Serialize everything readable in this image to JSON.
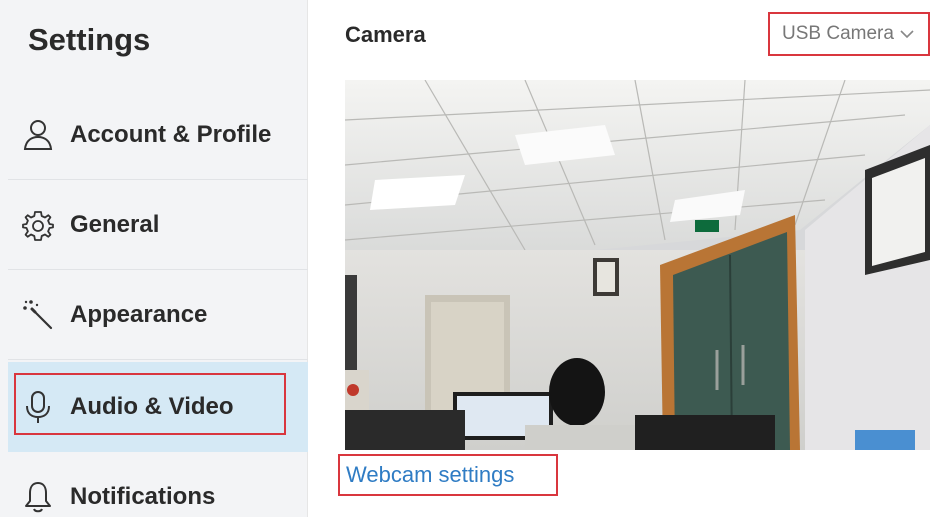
{
  "sidebar": {
    "title": "Settings",
    "items": [
      {
        "label": "Account & Profile",
        "icon": "person-icon"
      },
      {
        "label": "General",
        "icon": "gear-icon"
      },
      {
        "label": "Appearance",
        "icon": "magic-wand-icon"
      },
      {
        "label": "Audio & Video",
        "icon": "microphone-icon",
        "active": true
      },
      {
        "label": "Notifications",
        "icon": "bell-icon"
      }
    ]
  },
  "main": {
    "section_title": "Camera",
    "camera_select": {
      "value": "USB Camera",
      "icon": "chevron-down-icon"
    },
    "webcam_settings_link": "Webcam settings"
  },
  "colors": {
    "sidebar_bg": "#f3f4f6",
    "active_bg": "#d5e9f5",
    "link": "#2f7cc4",
    "highlight_box": "#d9363e"
  }
}
